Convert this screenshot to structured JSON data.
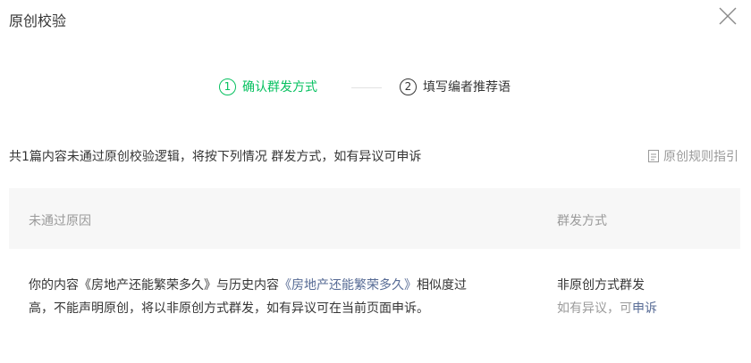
{
  "dialog": {
    "title": "原创校验",
    "close_icon": "close-icon"
  },
  "steps": [
    {
      "number": "1",
      "label": "确认群发方式",
      "active": true
    },
    {
      "number": "2",
      "label": "填写编者推荐语",
      "active": false
    }
  ],
  "summary": "共1篇内容未通过原创校验逻辑，将按下列情况 群发方式，如有异议可申诉",
  "guide_link": {
    "icon": "document-icon",
    "label": "原创规则指引"
  },
  "table": {
    "headers": {
      "reason": "未通过原因",
      "method": "群发方式"
    },
    "rows": [
      {
        "reason_prefix": "你的内容《房地产还能繁荣多久》与历史内容",
        "reason_link": "《房地产还能繁荣多久》",
        "reason_suffix": "相似度过高，不能声明原创，将以非原创方式群发，如有异议可在当前页面申诉。",
        "method_main": "非原创方式群发",
        "method_sub": "如有异议，可",
        "appeal_link": "申诉"
      }
    ]
  },
  "colors": {
    "accent_green": "#07c160",
    "link_blue": "#576b95",
    "muted_gray": "#9a9a9a",
    "text": "#353535",
    "header_bg": "#f7f7f7"
  }
}
